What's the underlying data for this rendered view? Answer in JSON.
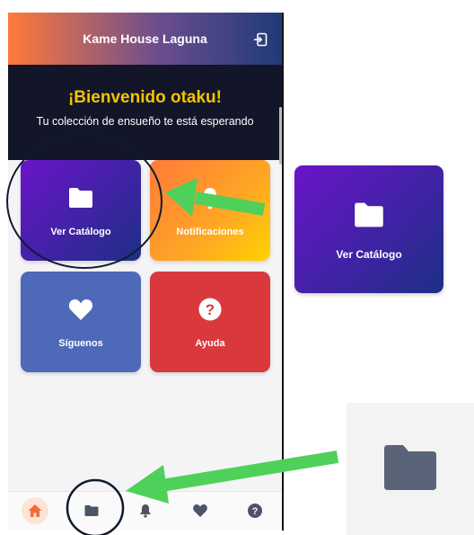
{
  "header": {
    "title": "Kame House Laguna"
  },
  "welcome": {
    "title": "¡Bienvenido otaku!",
    "subtitle": "Tu colección de ensueño te está esperando"
  },
  "cards": [
    {
      "label": "Ver Catálogo",
      "icon": "folder-icon"
    },
    {
      "label": "Notificaciones",
      "icon": "bell-icon"
    },
    {
      "label": "Síguenos",
      "icon": "heart-icon"
    },
    {
      "label": "Ayuda",
      "icon": "question-icon"
    }
  ],
  "bottom_nav": [
    {
      "icon": "home-icon",
      "active": true
    },
    {
      "icon": "folder-icon"
    },
    {
      "icon": "bell-icon"
    },
    {
      "icon": "heart-icon"
    },
    {
      "icon": "question-icon"
    }
  ],
  "zoom_card": {
    "label": "Ver Catálogo",
    "icon": "folder-icon"
  },
  "colors": {
    "header_start": "#ff7a3a",
    "header_end": "#203a78",
    "welcome_bg": "#131528",
    "welcome_title": "#f3c400",
    "catalog_start": "#6a14c9",
    "catalog_end": "#1d2f86",
    "follow": "#4e69b8",
    "help": "#d9393d",
    "home_active": "#f26b3a",
    "arrow": "#4fd05a"
  }
}
